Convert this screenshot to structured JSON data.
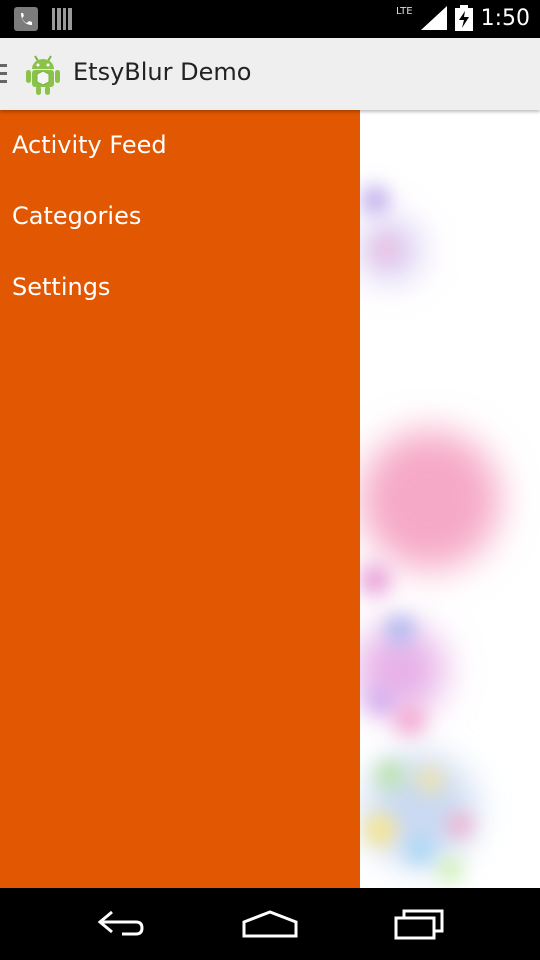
{
  "status_bar": {
    "time": "1:50",
    "network": "LTE",
    "icons": [
      "phone-ip-icon",
      "barcode-icon",
      "signal-icon",
      "battery-charging-icon"
    ]
  },
  "action_bar": {
    "title": "EtsyBlur Demo",
    "icons": [
      "drawer-indicator-icon",
      "android-app-icon"
    ]
  },
  "drawer": {
    "background": "#e25702",
    "items": [
      {
        "label": "Activity Feed"
      },
      {
        "label": "Categories"
      },
      {
        "label": "Settings"
      }
    ]
  },
  "navigation_bar": {
    "icons": [
      "back-icon",
      "home-icon",
      "recents-icon"
    ]
  },
  "colors": {
    "action_bar": "#efefef",
    "drawer": "#e25702",
    "system_bars": "#000000"
  }
}
